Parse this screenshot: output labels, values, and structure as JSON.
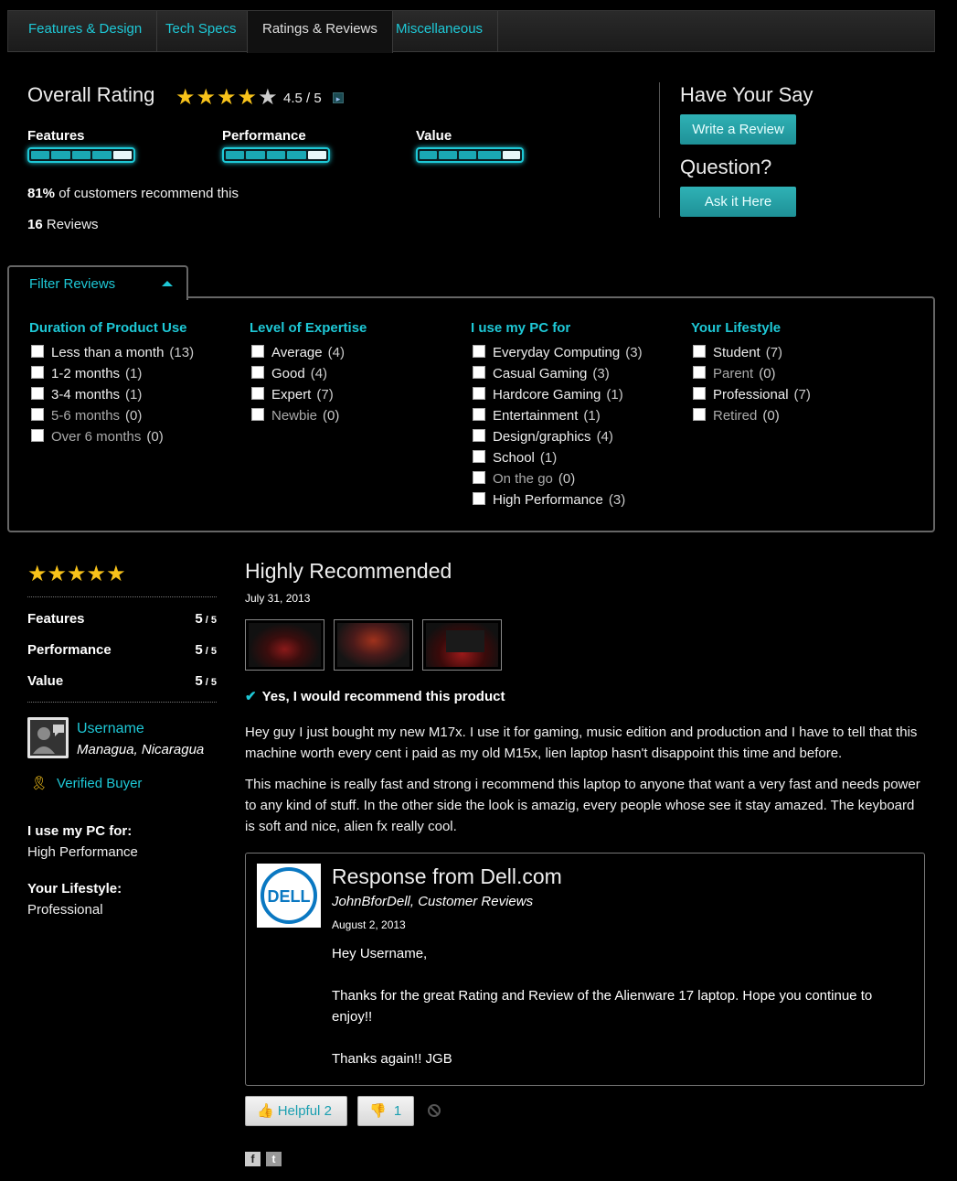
{
  "tabs": [
    "Features & Design",
    "Tech Specs",
    "Ratings & Reviews",
    "Miscellaneous"
  ],
  "overall": {
    "title": "Overall Rating",
    "stars": "★★★★",
    "star_empty": "★",
    "score": "4.5 / 5",
    "bars": [
      {
        "label": "Features",
        "value": 0.92
      },
      {
        "label": "Performance",
        "value": 0.92
      },
      {
        "label": "Value",
        "value": 0.82
      }
    ],
    "recommend_pct": "81%",
    "recommend_text": "of customers recommend this",
    "reviews_num": "16",
    "reviews_text": "Reviews"
  },
  "side": {
    "have_say": "Have Your Say",
    "write_review": "Write a Review",
    "question": "Question?",
    "ask": "Ask it Here"
  },
  "filter": {
    "title": "Filter Reviews",
    "columns": [
      {
        "heading": "Duration of Product Use",
        "items": [
          {
            "label": "Less than a month",
            "count": "(13)"
          },
          {
            "label": "1-2 months",
            "count": "(1)"
          },
          {
            "label": "3-4 months",
            "count": "(1)"
          },
          {
            "label": "5-6 months",
            "count": "(0)"
          },
          {
            "label": "Over 6 months",
            "count": "(0)"
          }
        ]
      },
      {
        "heading": "Level of Expertise",
        "items": [
          {
            "label": "Average",
            "count": "(4)"
          },
          {
            "label": "Good",
            "count": "(4)"
          },
          {
            "label": "Expert",
            "count": "(7)"
          },
          {
            "label": "Newbie",
            "count": "(0)"
          }
        ]
      },
      {
        "heading": "I use my PC for",
        "items": [
          {
            "label": "Everyday Computing",
            "count": "(3)"
          },
          {
            "label": "Casual Gaming",
            "count": "(3)"
          },
          {
            "label": "Hardcore Gaming",
            "count": "(1)"
          },
          {
            "label": "Entertainment",
            "count": "(1)"
          },
          {
            "label": "Design/graphics",
            "count": "(4)"
          },
          {
            "label": "School",
            "count": "(1)"
          },
          {
            "label": "On the go",
            "count": "(0)"
          },
          {
            "label": "High Performance",
            "count": "(3)"
          }
        ]
      },
      {
        "heading": "Your Lifestyle",
        "items": [
          {
            "label": "Student",
            "count": "(7)"
          },
          {
            "label": "Parent",
            "count": "(0)"
          },
          {
            "label": "Professional",
            "count": "(7)"
          },
          {
            "label": "Retired",
            "count": "(0)"
          }
        ]
      }
    ]
  },
  "review": {
    "stars": "★★★★★",
    "ratings": [
      {
        "label": "Features",
        "score": "5",
        "out": " / 5"
      },
      {
        "label": "Performance",
        "score": "5",
        "out": " / 5"
      },
      {
        "label": "Value",
        "score": "5",
        "out": " / 5"
      }
    ],
    "username": "Username",
    "location": "Managua, Nicaragua",
    "verified": "Verified Buyer",
    "use_heading": "I use my PC for:",
    "use_value": "High Performance",
    "lifestyle_heading": "Your Lifestyle:",
    "lifestyle_value": "Professional",
    "title": "Highly Recommended",
    "date": "July 31, 2013",
    "recommend": "Yes, I would recommend this product",
    "body1": "Hey guy I just bought my new M17x. I use it for gaming, music edition and production and I have to tell that this machine worth every cent i paid as my old M15x, lien laptop hasn't disappoint this time and before.",
    "body2": "This machine is really fast and strong i recommend this laptop to anyone that want a very fast and needs power to any kind of stuff. In the other side the look is amazig, every people whose see it stay amazed. The keyboard is soft and nice, alien fx really cool."
  },
  "response": {
    "logo_text": "DELL",
    "title": "Response from Dell.com",
    "author_name": "JohnBforDell",
    "author_role": ", Customer Reviews",
    "date": "August 2, 2013",
    "greeting": "Hey Username,",
    "para": "Thanks for the great Rating and Review of the Alienware 17 laptop. Hope you continue to enjoy!!",
    "signoff": "Thanks again!! JGB"
  },
  "helpful": {
    "label": "Helpful",
    "count": "2",
    "unhelpful_count": "1"
  },
  "social": {
    "facebook": "f",
    "twitter": "t"
  }
}
